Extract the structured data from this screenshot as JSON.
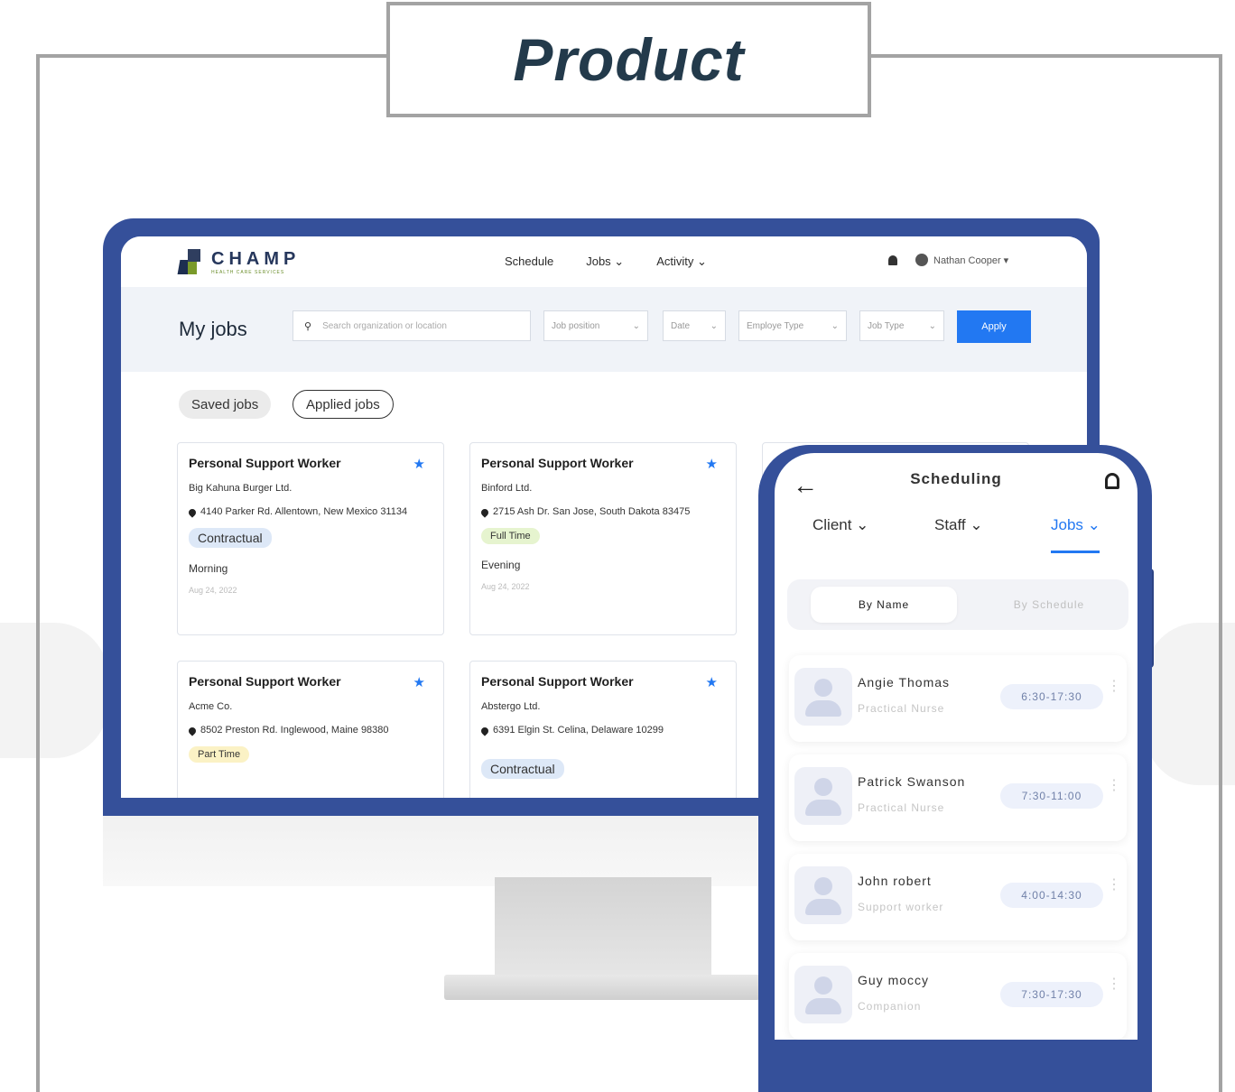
{
  "page": {
    "title": "Product"
  },
  "desktop": {
    "logo": {
      "name": "CHAMP",
      "sub": "HEALTH CARE SERVICES"
    },
    "nav": {
      "schedule": "Schedule",
      "jobs": "Jobs ⌄",
      "activity": "Activity ⌄"
    },
    "user": {
      "name": "Nathan Cooper ▾"
    },
    "page_heading": "My jobs",
    "filters": {
      "search_placeholder": "Search organization or location",
      "job_position": "Job position",
      "date": "Date",
      "employ_type": "Employe Type",
      "job_type": "Job Type",
      "apply": "Apply"
    },
    "chips": {
      "saved": "Saved jobs",
      "applied": "Applied jobs"
    },
    "cards": [
      {
        "title": "Personal Support Worker",
        "company": "Big Kahuna Burger Ltd.",
        "location": "4140 Parker Rd. Allentown, New Mexico 31134",
        "type": "Contractual",
        "shift": "Morning",
        "date": "Aug 24, 2022"
      },
      {
        "title": "Personal Support Worker",
        "company": "Binford Ltd.",
        "location": "2715 Ash Dr. San Jose, South Dakota 83475",
        "type": "Full Time",
        "shift": "Evening",
        "date": "Aug 24, 2022"
      },
      {
        "title": "Personal Support Worker",
        "company": "Acme Co.",
        "location": "8502 Preston Rd. Inglewood, Maine 98380",
        "type": "Part Time"
      },
      {
        "title": "Personal Support Worker",
        "company": "Abstergo Ltd.",
        "location": "6391 Elgin St. Celina, Delaware 10299",
        "type": "Contractual"
      }
    ],
    "star_icon": "★"
  },
  "mobile": {
    "back_icon": "←",
    "title": "Scheduling",
    "tabs": {
      "client": "Client ⌄",
      "staff": "Staff ⌄",
      "jobs": "Jobs ⌄"
    },
    "segments": {
      "by_name": "By Name",
      "by_schedule": "By Schedule"
    },
    "staff": [
      {
        "name": "Angie Thomas",
        "role": "Practical Nurse",
        "time": "6:30-17:30"
      },
      {
        "name": "Patrick Swanson",
        "role": "Practical Nurse",
        "time": "7:30-11:00"
      },
      {
        "name": "John robert",
        "role": "Support worker",
        "time": "4:00-14:30"
      },
      {
        "name": "Guy moccy",
        "role": "Companion",
        "time": "7:30-17:30"
      }
    ],
    "more_icon": "⋮"
  },
  "colors": {
    "accent": "#2278f2",
    "frame": "#35509a",
    "title": "#233a4b"
  }
}
